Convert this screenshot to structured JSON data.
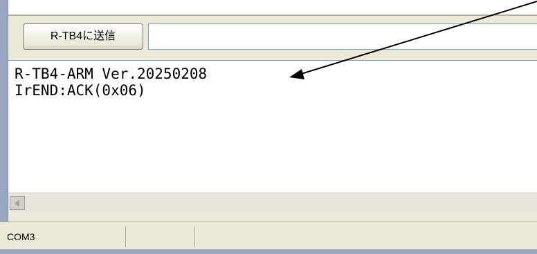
{
  "toolbar": {
    "send_button_label": "R-TB4に送信",
    "send_input_value": ""
  },
  "log": {
    "lines": [
      "R-TB4-ARM Ver.20250208",
      "IrEND:ACK(0x06)"
    ]
  },
  "statusbar": {
    "port": "COM3",
    "field2": ""
  },
  "icons": {
    "scroll_left": "triangle-left-icon",
    "annotation": "arrow-icon"
  }
}
